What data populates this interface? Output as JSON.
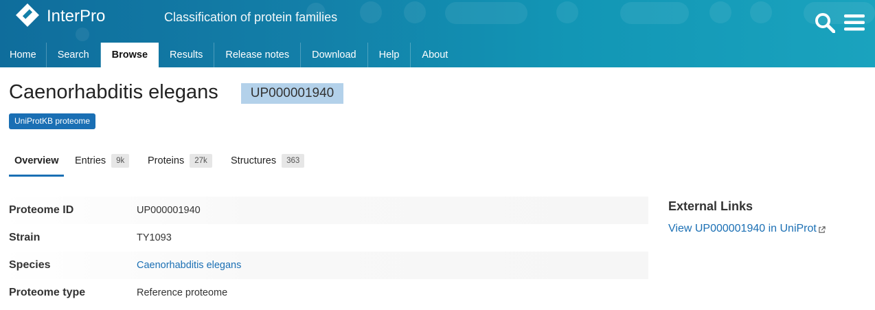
{
  "header": {
    "logo_text": "InterPro",
    "site_title": "Classification of protein families",
    "search_icon": "search-icon",
    "menu_icon": "hamburger-menu-icon"
  },
  "nav": {
    "items": [
      {
        "label": "Home"
      },
      {
        "label": "Search"
      },
      {
        "label": "Browse",
        "active": true
      },
      {
        "label": "Results"
      },
      {
        "label": "Release notes"
      },
      {
        "label": "Download"
      },
      {
        "label": "Help"
      },
      {
        "label": "About"
      }
    ]
  },
  "page": {
    "title": "Caenorhabditis elegans",
    "accession": "UP000001940",
    "badge": "UniProtKB proteome"
  },
  "tabs": [
    {
      "label": "Overview",
      "active": true
    },
    {
      "label": "Entries",
      "count": "9k"
    },
    {
      "label": "Proteins",
      "count": "27k"
    },
    {
      "label": "Structures",
      "count": "363"
    }
  ],
  "details": [
    {
      "label": "Proteome ID",
      "value": "UP000001940"
    },
    {
      "label": "Strain",
      "value": "TY1093"
    },
    {
      "label": "Species",
      "value": "Caenorhabditis elegans",
      "link": true
    },
    {
      "label": "Proteome type",
      "value": "Reference proteome"
    }
  ],
  "external_links": {
    "title": "External Links",
    "link_text": "View UP000001940 in UniProt",
    "link_icon": "external-link-icon"
  },
  "colors": {
    "brand_blue": "#1a6fb4",
    "accession_highlight": "#b3d1ea",
    "header_gradient_start": "#0f6d9c",
    "header_gradient_end": "#1aa3be"
  }
}
